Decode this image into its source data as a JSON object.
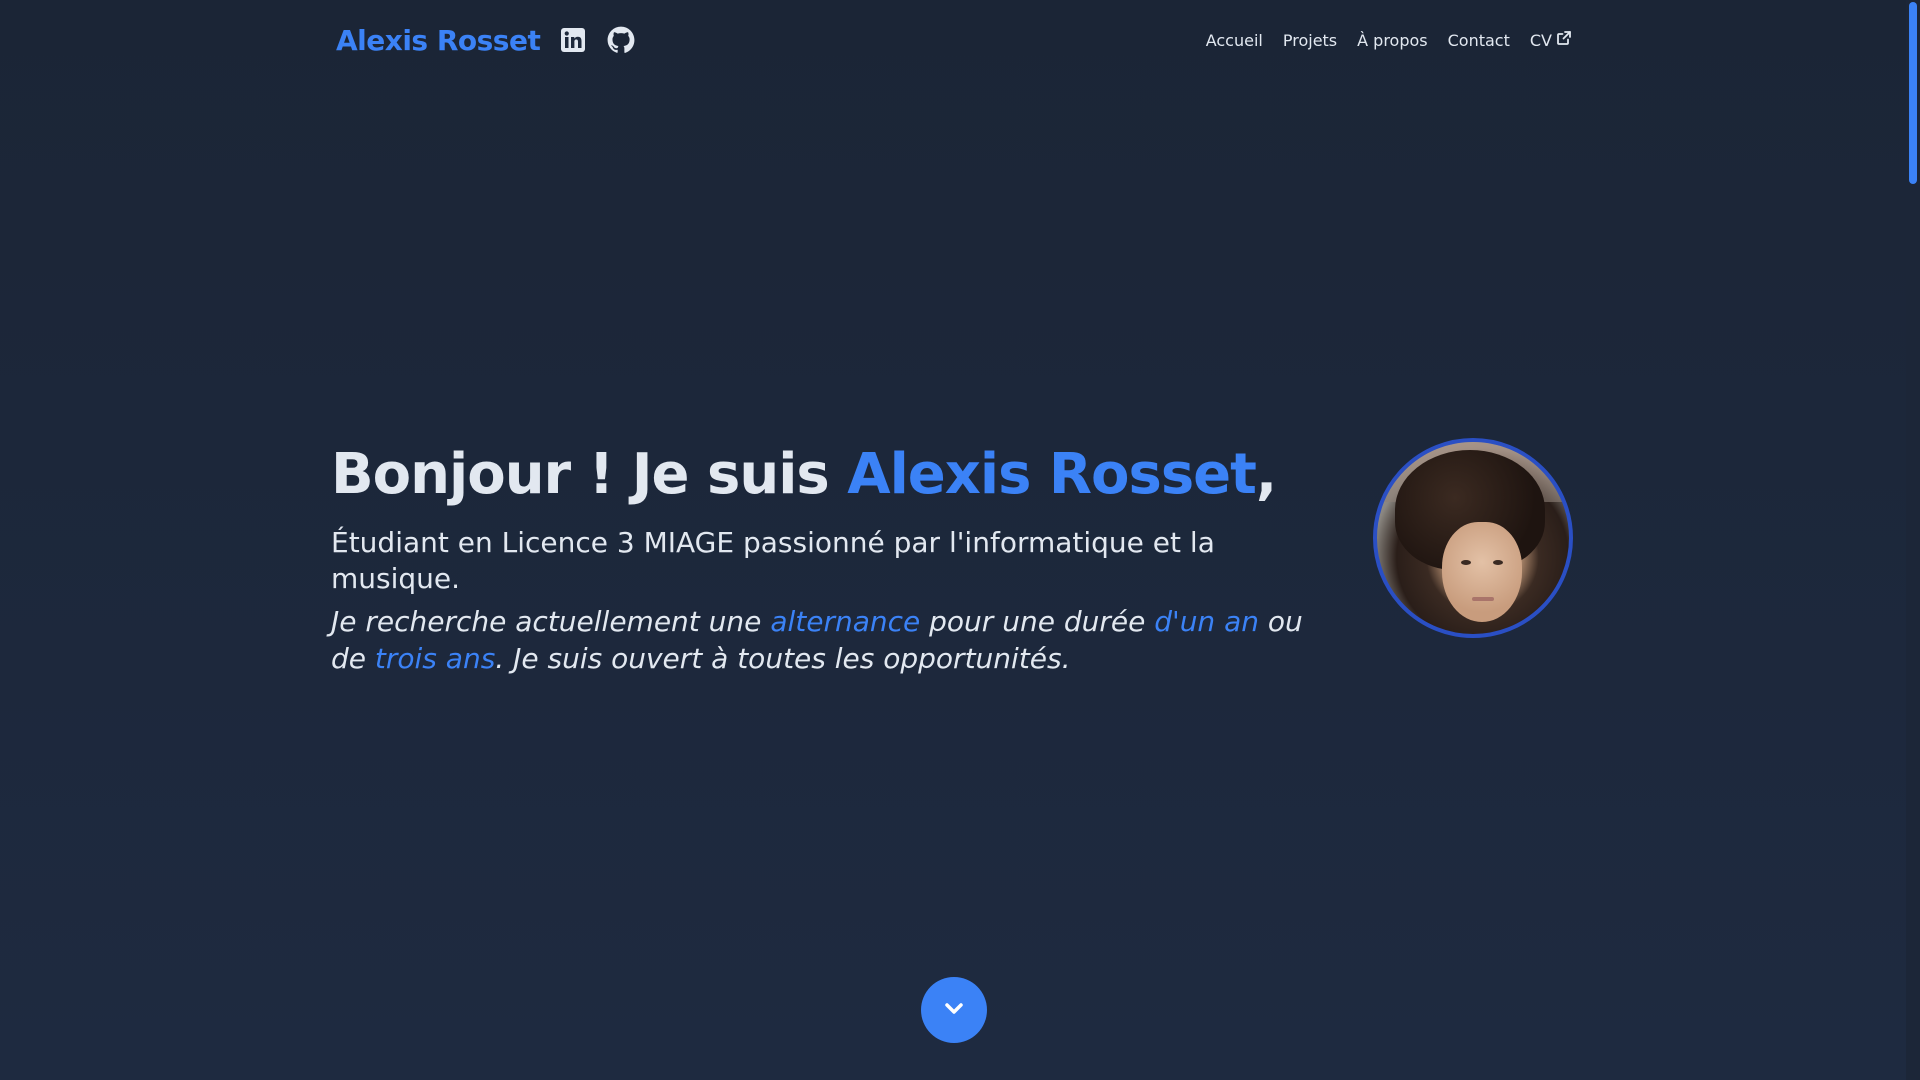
{
  "header": {
    "brand": "Alexis Rosset",
    "social": [
      {
        "icon": "linkedin-icon"
      },
      {
        "icon": "github-icon"
      }
    ],
    "nav": {
      "home": "Accueil",
      "projects": "Projets",
      "about": "À propos",
      "contact": "Contact",
      "cv": "CV"
    }
  },
  "hero": {
    "greeting": "Bonjour ! Je suis ",
    "name": "Alexis Rosset",
    "comma": ",",
    "subtitle": "Étudiant en Licence 3 MIAGE passionné par l'informatique et la musique.",
    "desc_part1": "Je recherche actuellement une ",
    "desc_hl1": "alternance",
    "desc_part2": " pour une durée ",
    "desc_hl2": "d'un an",
    "desc_part3": " ou de ",
    "desc_hl3": "trois ans",
    "desc_part4": ". Je suis ouvert à toutes les opportunités."
  },
  "colors": {
    "background": "#1e293b",
    "accent": "#3b82f6",
    "text": "#e2e8f0"
  },
  "scroll_button": {
    "icon": "chevron-down-icon"
  }
}
